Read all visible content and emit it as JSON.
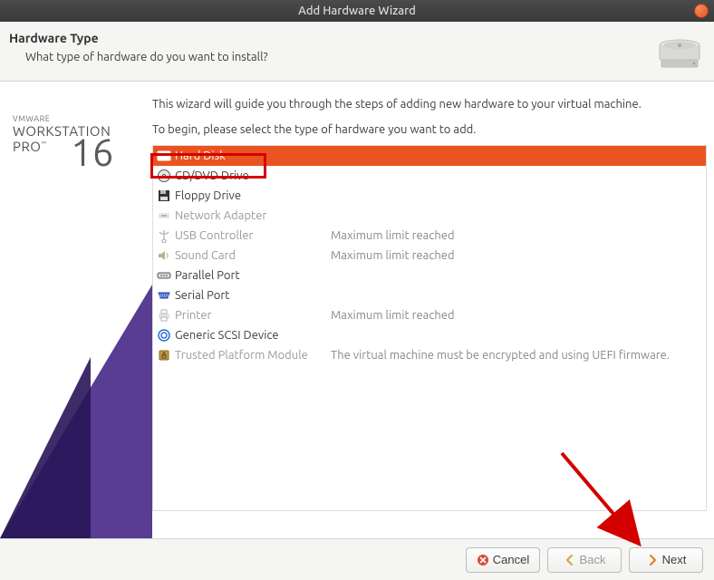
{
  "window": {
    "title": "Add Hardware Wizard"
  },
  "header": {
    "title": "Hardware Type",
    "subtitle": "What type of hardware do you want to install?"
  },
  "branding": {
    "line1": "VMWARE",
    "line2": "WORKSTATION",
    "line3": "PRO",
    "version": "16"
  },
  "content": {
    "intro1": "This wizard will guide you through the steps of adding new hardware to your virtual machine.",
    "intro2": "To begin, please select the type of hardware you want to add."
  },
  "hardware_items": [
    {
      "icon": "hdd-icon",
      "label": "Hard Disk",
      "note": "",
      "selected": true,
      "disabled": false
    },
    {
      "icon": "cd-icon",
      "label": "CD/DVD Drive",
      "note": "",
      "selected": false,
      "disabled": false
    },
    {
      "icon": "floppy-icon",
      "label": "Floppy Drive",
      "note": "",
      "selected": false,
      "disabled": false
    },
    {
      "icon": "network-icon",
      "label": "Network Adapter",
      "note": "",
      "selected": false,
      "disabled": true
    },
    {
      "icon": "usb-icon",
      "label": "USB Controller",
      "note": "Maximum limit reached",
      "selected": false,
      "disabled": true
    },
    {
      "icon": "sound-icon",
      "label": "Sound Card",
      "note": "Maximum limit reached",
      "selected": false,
      "disabled": true
    },
    {
      "icon": "parallel-icon",
      "label": "Parallel Port",
      "note": "",
      "selected": false,
      "disabled": false
    },
    {
      "icon": "serial-icon",
      "label": "Serial Port",
      "note": "",
      "selected": false,
      "disabled": false
    },
    {
      "icon": "printer-icon",
      "label": "Printer",
      "note": "Maximum limit reached",
      "selected": false,
      "disabled": true
    },
    {
      "icon": "scsi-icon",
      "label": "Generic SCSI Device",
      "note": "",
      "selected": false,
      "disabled": false
    },
    {
      "icon": "tpm-icon",
      "label": "Trusted Platform Module",
      "note": "The virtual machine must be encrypted and using UEFI firmware.",
      "selected": false,
      "disabled": true
    }
  ],
  "footer": {
    "cancel": "Cancel",
    "back": "Back",
    "next": "Next"
  }
}
